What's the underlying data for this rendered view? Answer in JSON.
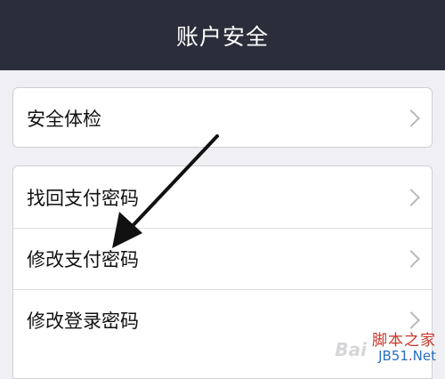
{
  "header": {
    "title": "账户安全"
  },
  "groups": [
    {
      "items": [
        {
          "label": "安全体检"
        }
      ]
    },
    {
      "items": [
        {
          "label": "找回支付密码"
        },
        {
          "label": "修改支付密码"
        },
        {
          "label": "修改登录密码"
        }
      ]
    }
  ],
  "watermark": {
    "logo": "Bai",
    "cn": "脚本之家",
    "site_main": "JB51",
    "site_dot": ".",
    "site_tld": "Net"
  },
  "colors": {
    "header_bg": "#2b2d3a",
    "page_bg": "#efeff4",
    "arrow": "#111111"
  }
}
